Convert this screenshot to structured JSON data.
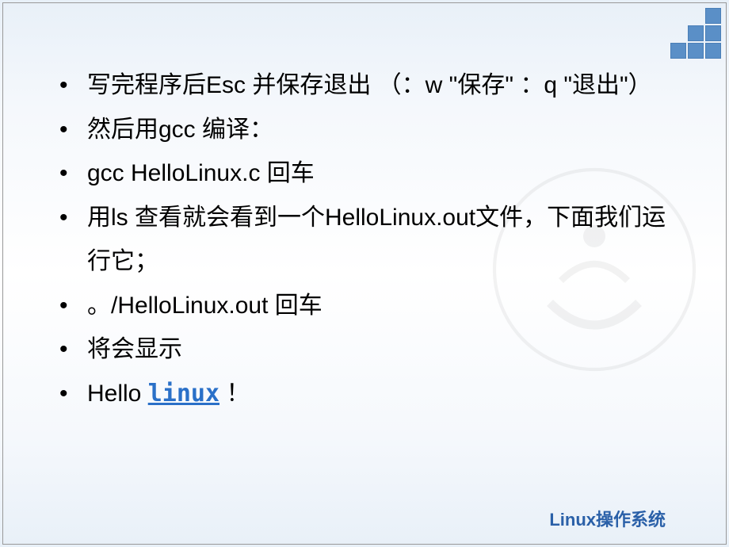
{
  "bullets": [
    {
      "text": "    写完程序后Esc 并保存退出 （：w \"保存\" ：q \"退出\"）"
    },
    {
      "text": "    然后用gcc 编译："
    },
    {
      "text": "    gcc HelloLinux.c 回车"
    },
    {
      "text": "    用ls 查看就会看到一个HelloLinux.out文件，下面我们运行它；"
    },
    {
      "text": "    。/HelloLinux.out 回车"
    },
    {
      "text": "    将会显示"
    },
    {
      "prefix": "    Hello ",
      "link": "linux",
      "suffix": " ！"
    }
  ],
  "footer": "Linux操作系统"
}
